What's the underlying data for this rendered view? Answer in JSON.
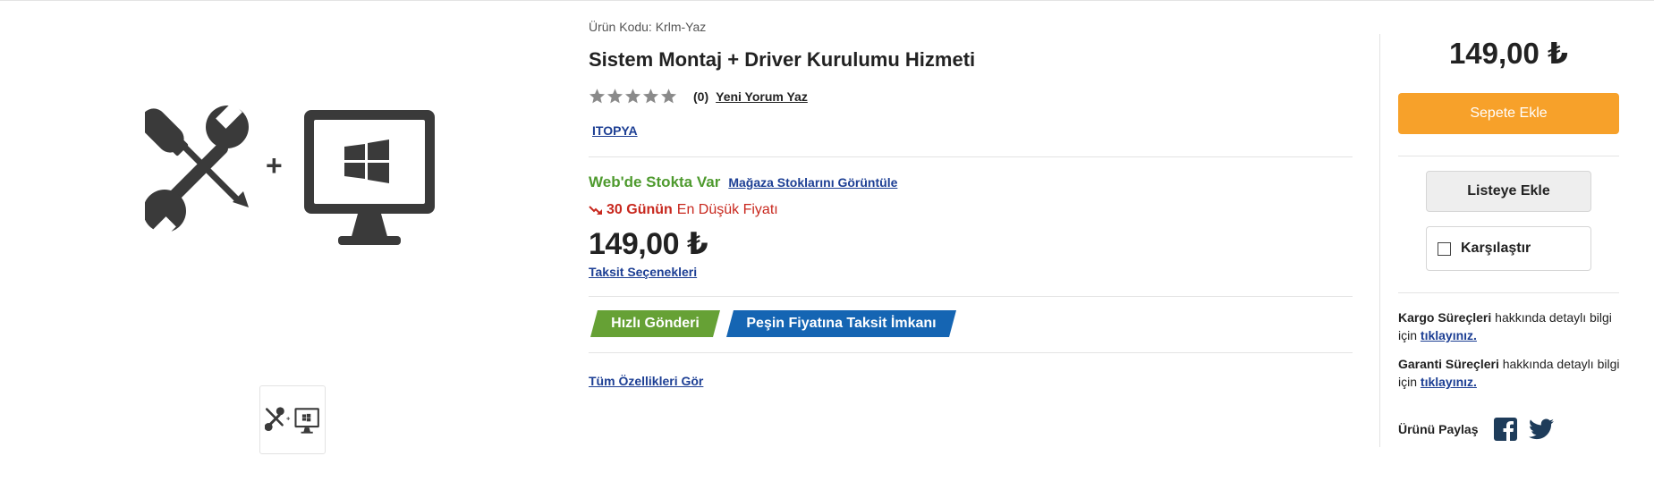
{
  "product": {
    "code_label": "Ürün Kodu:",
    "code_value": "Krlm-Yaz",
    "title": "Sistem Montaj + Driver Kurulumu Hizmeti",
    "rating_stars": 0,
    "review_count": "(0)",
    "write_review": "Yeni Yorum Yaz",
    "brand": "ITOPYA",
    "stock_text": "Web'de Stokta Var",
    "store_stock_link": "Mağaza Stoklarını Görüntüle",
    "lowest_days": "30 Günün",
    "lowest_rest": "En Düşük Fiyatı",
    "price": "149,00 ₺",
    "installments_link": "Taksit Seçenekleri",
    "badge_fast": "Hızlı Gönderi",
    "badge_installment": "Peşin Fiyatına Taksit İmkanı",
    "all_features": "Tüm Özellikleri Gör"
  },
  "side": {
    "price": "149,00 ₺",
    "add_to_cart": "Sepete Ekle",
    "add_to_list": "Listeye Ekle",
    "compare": "Karşılaştır",
    "compare_checked": false,
    "cargo_strong": "Kargo Süreçleri",
    "cargo_text": "hakkında detaylı bilgi için",
    "cargo_link": "tıklayınız.",
    "warranty_strong": "Garanti Süreçleri",
    "warranty_text": "hakkında detaylı bilgi için",
    "warranty_link": "tıklayınız.",
    "share_label": "Ürünü Paylaş"
  },
  "icons": {
    "main_image": "tools-plus-windows-monitor",
    "thumbnail": "tools-plus-windows-monitor",
    "facebook": "facebook-icon",
    "twitter": "twitter-icon",
    "price_down": "arrow-down-icon"
  },
  "colors": {
    "cart_button": "#f7a12a",
    "badge_green": "#66a135",
    "badge_blue": "#1565b3",
    "stock_green": "#4e9a2e",
    "lowest_red": "#c8281e",
    "link_blue": "#1d3f94",
    "icon_dark": "#3a3a3a",
    "share_icon": "#1e3c5a"
  }
}
